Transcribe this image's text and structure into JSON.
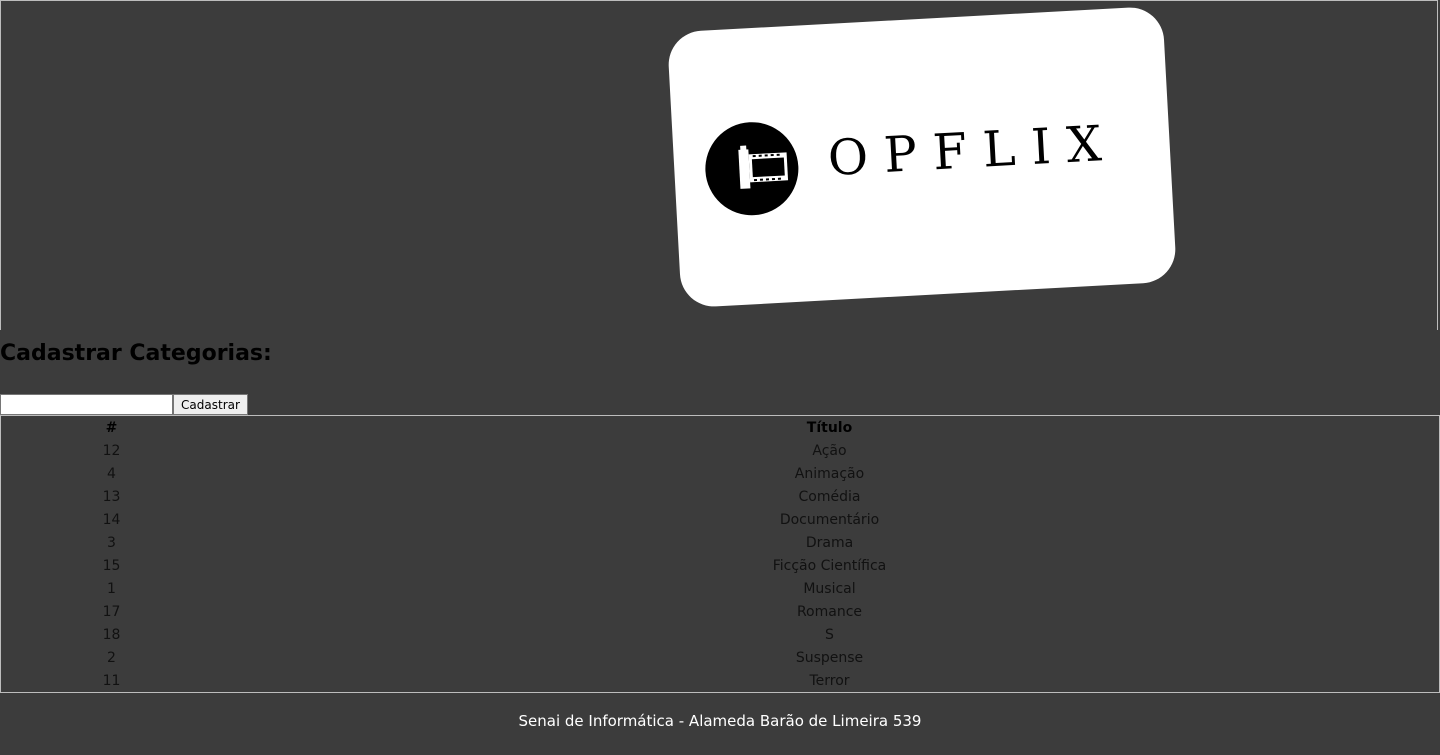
{
  "header": {
    "logo_text": "OPFLIX",
    "logo_icon": "film-roll-icon"
  },
  "form": {
    "title": "Cadastrar Categorias:",
    "input_value": "",
    "submit_label": "Cadastrar"
  },
  "table": {
    "headers": [
      "#",
      "Título"
    ],
    "rows": [
      {
        "id": "12",
        "title": "Ação"
      },
      {
        "id": "4",
        "title": "Animação"
      },
      {
        "id": "13",
        "title": "Comédia"
      },
      {
        "id": "14",
        "title": "Documentário"
      },
      {
        "id": "3",
        "title": "Drama"
      },
      {
        "id": "15",
        "title": "Ficção Científica"
      },
      {
        "id": "1",
        "title": "Musical"
      },
      {
        "id": "17",
        "title": "Romance"
      },
      {
        "id": "18",
        "title": "S"
      },
      {
        "id": "2",
        "title": "Suspense"
      },
      {
        "id": "11",
        "title": "Terror"
      }
    ]
  },
  "footer": {
    "text": "Senai de Informática - Alameda Barão de Limeira 539"
  },
  "colors": {
    "background": "#3c3c3c",
    "logo_card": "#ffffff",
    "footer_text": "#ffffff"
  }
}
